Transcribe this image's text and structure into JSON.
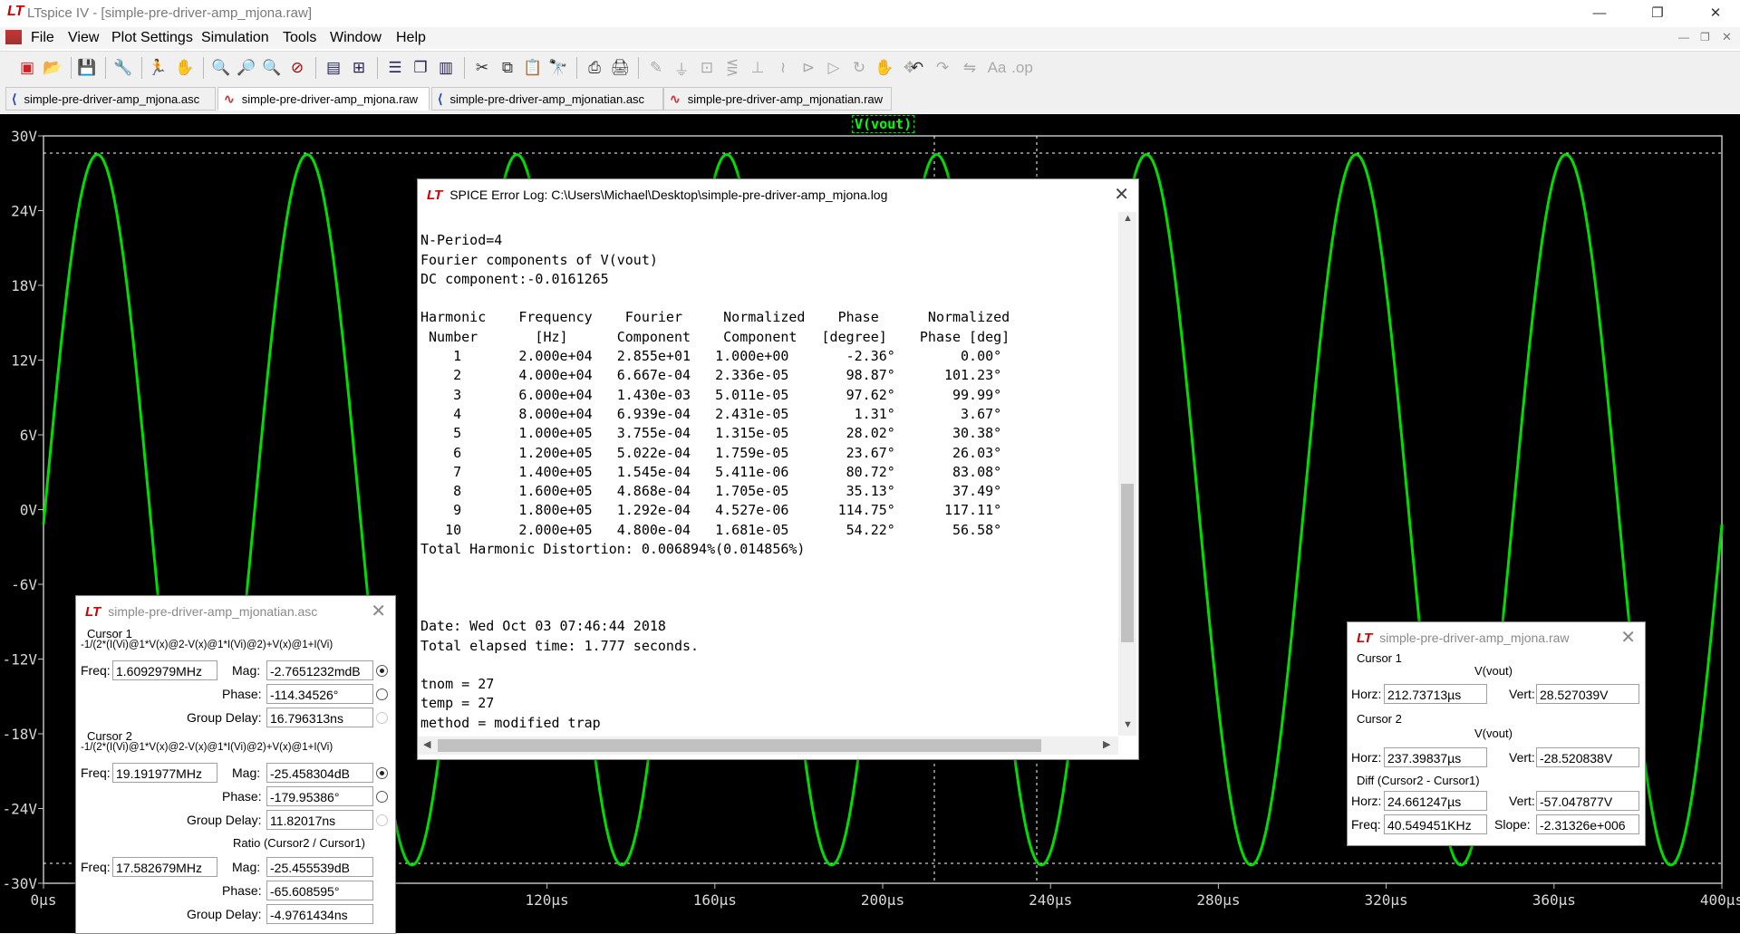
{
  "window": {
    "title": "LTspice IV - [simple-pre-driver-amp_mjona.raw]",
    "controls": {
      "minimize": "—",
      "restore": "❐",
      "close": "✕"
    }
  },
  "menu": [
    "File",
    "View",
    "Plot Settings",
    "Simulation",
    "Tools",
    "Window",
    "Help"
  ],
  "tabs": [
    {
      "label": "simple-pre-driver-amp_mjona.asc",
      "icon": "schematic-icon"
    },
    {
      "label": "simple-pre-driver-amp_mjona.raw",
      "icon": "waveform-icon"
    },
    {
      "label": "simple-pre-driver-amp_mjonatian.asc",
      "icon": "schematic-icon"
    },
    {
      "label": "simple-pre-driver-amp_mjonatian.raw",
      "icon": "waveform-icon"
    }
  ],
  "plot": {
    "trace_label": "V(vout)",
    "trace_color": "#00dd00",
    "y_ticks": [
      "30V",
      "24V",
      "18V",
      "12V",
      "6V",
      "0V",
      "-6V",
      "-12V",
      "-18V",
      "-24V",
      "-30V"
    ],
    "x_ticks": [
      "0µs",
      "40µs",
      "80µs",
      "120µs",
      "160µs",
      "200µs",
      "240µs",
      "280µs",
      "320µs",
      "360µs",
      "400µs"
    ]
  },
  "chart_data": {
    "type": "line",
    "title": "",
    "xlabel": "",
    "ylabel": "",
    "xlim": [
      0,
      400
    ],
    "ylim": [
      -30,
      30
    ],
    "x_unit": "µs",
    "y_unit": "V",
    "grid": false,
    "series": [
      {
        "name": "V(vout)",
        "color": "#00dd00",
        "amplitude": 28.52,
        "frequency_khz": 20,
        "phase_deg": -2.36,
        "dc": -0.0161265
      }
    ]
  },
  "error_log": {
    "title": "SPICE Error Log: C:\\Users\\Michael\\Desktop\\simple-pre-driver-amp_mjona.log",
    "lines": [
      "",
      "N-Period=4",
      "Fourier components of V(vout)",
      "DC component:-0.0161265",
      "",
      "Harmonic    Frequency    Fourier     Normalized    Phase      Normalized",
      " Number       [Hz]      Component    Component   [degree]    Phase [deg]",
      "    1       2.000e+04   2.855e+01   1.000e+00       -2.36°        0.00°",
      "    2       4.000e+04   6.667e-04   2.336e-05       98.87°      101.23°",
      "    3       6.000e+04   1.430e-03   5.011e-05       97.62°       99.99°",
      "    4       8.000e+04   6.939e-04   2.431e-05        1.31°        3.67°",
      "    5       1.000e+05   3.755e-04   1.315e-05       28.02°       30.38°",
      "    6       1.200e+05   5.022e-04   1.759e-05       23.67°       26.03°",
      "    7       1.400e+05   1.545e-04   5.411e-06       80.72°       83.08°",
      "    8       1.600e+05   4.868e-04   1.705e-05       35.13°       37.49°",
      "    9       1.800e+05   1.292e-04   4.527e-06      114.75°      117.11°",
      "   10       2.000e+05   4.800e-04   1.681e-05       54.22°       56.58°",
      "Total Harmonic Distortion: 0.006894%(0.014856%)",
      "",
      "",
      "",
      "Date: Wed Oct 03 07:46:44 2018",
      "Total elapsed time: 1.777 seconds.",
      "",
      "tnom = 27",
      "temp = 27",
      "method = modified trap"
    ]
  },
  "cursor_left": {
    "title": "simple-pre-driver-amp_mjonatian.asc",
    "c1_label": "Cursor 1",
    "c1_expr": "-1/(2*(I(Vi)@1*V(x)@2-V(x)@1*I(Vi)@2)+V(x)@1+I(Vi)",
    "c1_freq": "1.6092979MHz",
    "c1_mag": "-2.7651232mdB",
    "c1_phase": "-114.34526°",
    "c1_gd": "16.796313ns",
    "c2_label": "Cursor 2",
    "c2_expr": "-1/(2*(I(Vi)@1*V(x)@2-V(x)@1*I(Vi)@2)+V(x)@1+I(Vi)",
    "c2_freq": "19.191977MHz",
    "c2_mag": "-25.458304dB",
    "c2_phase": "-179.95386°",
    "c2_gd": "11.82017ns",
    "ratio_label": "Ratio (Cursor2 / Cursor1)",
    "r_freq": "17.582679MHz",
    "r_mag": "-25.455539dB",
    "r_phase": "-65.608595°",
    "r_gd": "-4.9761434ns",
    "freq_label": "Freq:",
    "mag_label": "Mag:",
    "phase_label": "Phase:",
    "gd_label": "Group Delay:"
  },
  "cursor_right": {
    "title": "simple-pre-driver-amp_mjona.raw",
    "c1_label": "Cursor 1",
    "c1_trace": "V(vout)",
    "c1_horz": "212.73713µs",
    "c1_vert": "28.527039V",
    "c2_label": "Cursor 2",
    "c2_trace": "V(vout)",
    "c2_horz": "237.39837µs",
    "c2_vert": "-28.520838V",
    "diff_label": "Diff (Cursor2 - Cursor1)",
    "d_horz": "24.661247µs",
    "d_vert": "-57.047877V",
    "d_freq": "40.549451KHz",
    "d_slope": "-2.31326e+006",
    "horz_label": "Horz:",
    "vert_label": "Vert:",
    "freq_label": "Freq:",
    "slope_label": "Slope:"
  }
}
